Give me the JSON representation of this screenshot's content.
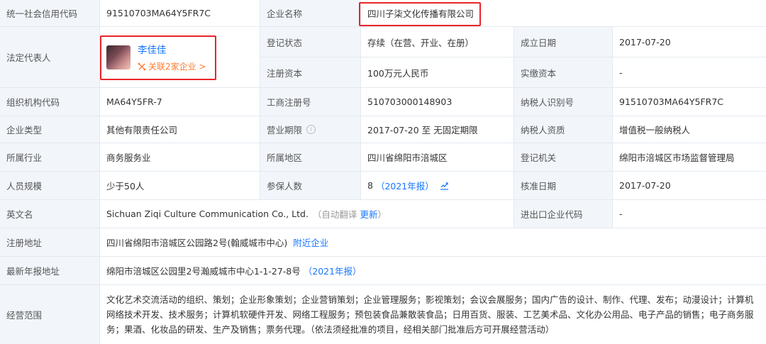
{
  "row1": {
    "credit_code_label": "统一社会信用代码",
    "credit_code": "91510703MA64Y5FR7C",
    "company_name_label": "企业名称",
    "company_name": "四川子柒文化传播有限公司"
  },
  "row2": {
    "legal_rep_label": "法定代表人",
    "legal_rep_name": "李佳佳",
    "legal_rep_related": "关联2家企业 >",
    "reg_status_label": "登记状态",
    "reg_status": "存续（在营、开业、在册）",
    "established_label": "成立日期",
    "established": "2017-07-20"
  },
  "row3": {
    "reg_capital_label": "注册资本",
    "reg_capital": "100万元人民币",
    "paid_capital_label": "实缴资本",
    "paid_capital": "-"
  },
  "row4": {
    "org_code_label": "组织机构代码",
    "org_code": "MA64Y5FR-7",
    "biz_reg_no_label": "工商注册号",
    "biz_reg_no": "510703000148903",
    "taxpayer_id_label": "纳税人识别号",
    "taxpayer_id": "91510703MA64Y5FR7C"
  },
  "row5": {
    "type_label": "企业类型",
    "type": "其他有限责任公司",
    "term_label": "营业期限",
    "term": "2017-07-20 至 无固定期限",
    "taxpayer_qual_label": "纳税人资质",
    "taxpayer_qual": "增值税一般纳税人"
  },
  "row6": {
    "industry_label": "所属行业",
    "industry": "商务服务业",
    "region_label": "所属地区",
    "region": "四川省绵阳市涪城区",
    "authority_label": "登记机关",
    "authority": "绵阳市涪城区市场监督管理局"
  },
  "row7": {
    "staff_label": "人员规模",
    "staff": "少于50人",
    "insured_label": "参保人数",
    "insured": "8",
    "insured_year": "（2021年报）",
    "approval_label": "核准日期",
    "approval": "2017-07-20"
  },
  "row8": {
    "english_label": "英文名",
    "english": "Sichuan Ziqi Culture Communication Co., Ltd.",
    "auto_translate": "（自动翻译",
    "update": "更新",
    "close_paren": "）",
    "import_export_label": "进出口企业代码",
    "import_export": "-"
  },
  "row9": {
    "address_label": "注册地址",
    "address": "四川省绵阳市涪城区公园路2号(翰威城市中心)",
    "nearby": "附近企业"
  },
  "row10": {
    "annual_addr_label": "最新年报地址",
    "annual_addr": "绵阳市涪城区公园里2号瀚威城市中心1-1-27-8号",
    "annual_year": "（2021年报）"
  },
  "row11": {
    "scope_label": "经营范围",
    "scope": "文化艺术交流活动的组织、策划；企业形象策划；企业营销策划；企业管理服务；影视策划；会议会展服务；国内广告的设计、制作、代理、发布；动漫设计；计算机网络技术开发、技术服务；计算机软硬件开发、网络工程服务；预包装食品兼散装食品；日用百货、服装、工艺美术品、文化办公用品、电子产品的销售；电子商务服务；果酒、化妆品的研发、生产及销售；票务代理。（依法须经批准的项目，经相关部门批准后方可开展经营活动）"
  },
  "colors": {
    "label_bg": "#f2f6fb",
    "border": "#e4e9f0",
    "link": "#1677ff",
    "orange": "#ff7a2f",
    "highlight": "#e8252b"
  },
  "icons": {
    "info": "info-circle-icon",
    "chart": "trend-chart-icon",
    "relation": "relation-icon"
  }
}
